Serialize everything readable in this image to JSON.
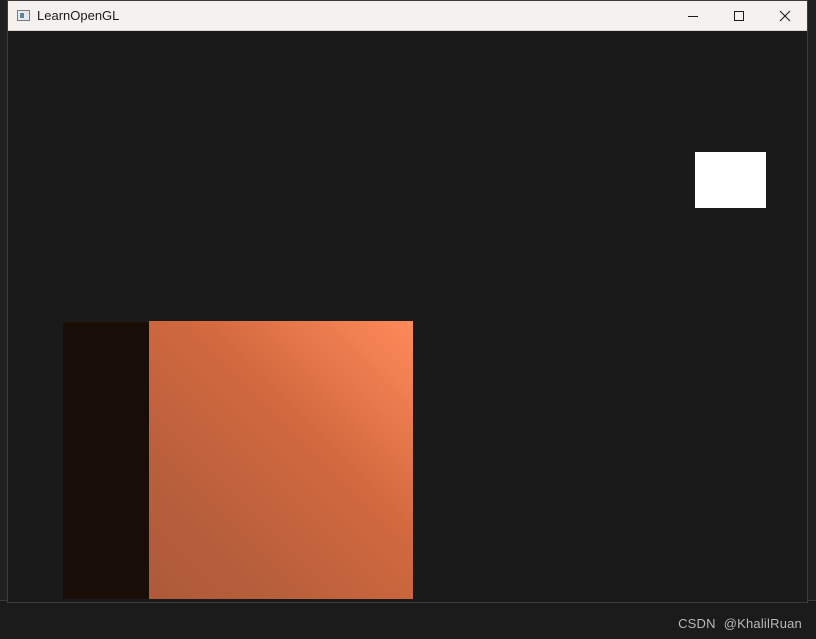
{
  "window": {
    "title": "LearnOpenGL",
    "controls": {
      "minimize": "minimize-icon",
      "maximize": "maximize-icon",
      "close": "close-icon"
    }
  },
  "scene": {
    "background_color": "#1a1a1a",
    "cube_color": "#ff7f50",
    "light_color": "#ffffff"
  },
  "watermark": {
    "site": "CSDN",
    "author": "@KhalilRuan"
  }
}
